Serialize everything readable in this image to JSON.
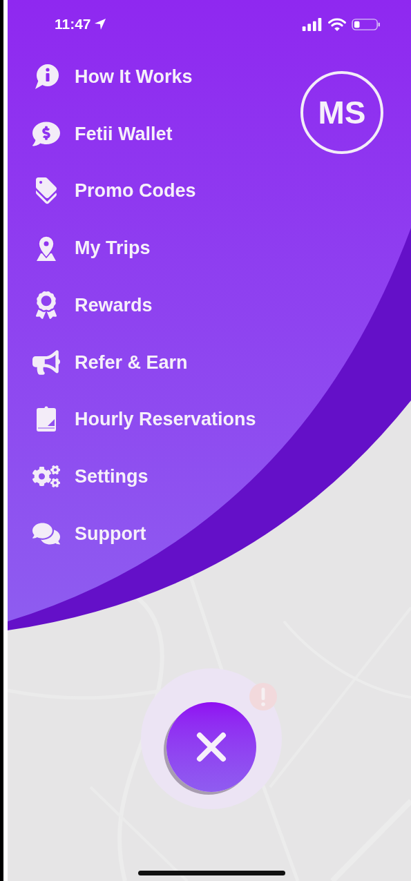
{
  "status_bar": {
    "time": "11:47"
  },
  "menu": {
    "items": [
      {
        "label": "How It Works"
      },
      {
        "label": "Fetii Wallet"
      },
      {
        "label": "Promo Codes"
      },
      {
        "label": "My Trips"
      },
      {
        "label": "Rewards"
      },
      {
        "label": "Refer & Earn"
      },
      {
        "label": "Hourly Reservations"
      },
      {
        "label": "Settings"
      },
      {
        "label": "Support"
      }
    ]
  },
  "profile": {
    "initials": "MS"
  }
}
